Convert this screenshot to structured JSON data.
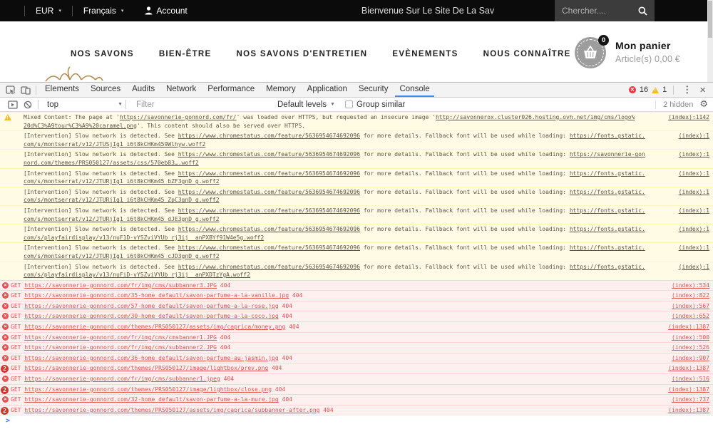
{
  "topbar": {
    "currency": "EUR",
    "language": "Français",
    "account": "Account",
    "welcome": "Bienvenue Sur Le Site De La Sav",
    "search_placeholder": "Chercher...."
  },
  "nav": {
    "items": [
      "NOS SAVONS",
      "BIEN-ÊTRE",
      "NOS SAVONS D'ENTRETIEN",
      "EVÈNEMENTS",
      "NOUS CONNAÎTRE"
    ],
    "cart": {
      "badge": "0",
      "label": "Mon panier",
      "summary": "Article(s) 0,00 €"
    }
  },
  "devtools": {
    "tabs": [
      "Elements",
      "Sources",
      "Audits",
      "Network",
      "Performance",
      "Memory",
      "Application",
      "Security",
      "Console"
    ],
    "active_tab": "Console",
    "error_count": "16",
    "warning_count": "1",
    "toolbar": {
      "context": "top",
      "filter_placeholder": "Filter",
      "levels": "Default levels",
      "group_similar": "Group similar",
      "hidden": "2 hidden"
    },
    "console": {
      "warnings": [
        {
          "icon": "warning",
          "source": "(index):1142",
          "line1": [
            {
              "t": "Mixed Content: The page at '"
            },
            {
              "t": "https://savonnerie-gonnord.com/fr/",
              "link": true
            },
            {
              "t": "' was loaded over HTTPS, but requested an insecure image '"
            },
            {
              "t": "http://savonnerox.cluster026.hosting.ovh.net/img/cms/logo%",
              "link": true
            }
          ],
          "line2": [
            {
              "t": "20d%C3%A9tour%C3%A9%20caramel.png",
              "link": true
            },
            {
              "t": "'. This content should also be served over HTTPS."
            }
          ]
        },
        {
          "icon": null,
          "source": "(index):1",
          "line1": [
            {
              "t": "[Intervention] Slow network is detected. See "
            },
            {
              "t": "https://www.chromestatus.com/feature/5636954674692096",
              "link": true
            },
            {
              "t": " for more details. Fallback font will be used while loading: "
            },
            {
              "t": "https://fonts.gstatic.",
              "link": true
            }
          ],
          "line2": [
            {
              "t": "com/s/montserrat/v12/JTUSjIg1_i6t8kCHKm459Wlhyw.woff2",
              "link": true
            }
          ]
        },
        {
          "icon": null,
          "source": "(index):1",
          "line1": [
            {
              "t": "[Intervention] Slow network is detected. See "
            },
            {
              "t": "https://www.chromestatus.com/feature/5636954674692096",
              "link": true
            },
            {
              "t": " for more details. Fallback font will be used while loading: "
            },
            {
              "t": "https://savonnerie-gon",
              "link": true
            }
          ],
          "line2": [
            {
              "t": "nord.com/themes/PRS050127/assets/css/570eb83….woff2",
              "link": true
            }
          ]
        },
        {
          "icon": null,
          "source": "(index):1",
          "line1": [
            {
              "t": "[Intervention] Slow network is detected. See "
            },
            {
              "t": "https://www.chromestatus.com/feature/5636954674692096",
              "link": true
            },
            {
              "t": " for more details. Fallback font will be used while loading: "
            },
            {
              "t": "https://fonts.gstatic.",
              "link": true
            }
          ],
          "line2": [
            {
              "t": "com/s/montserrat/v12/JTURjIg1_i6t8kCHKm45_bZF3gnD_g.woff2",
              "link": true
            }
          ]
        },
        {
          "icon": null,
          "source": "(index):1",
          "line1": [
            {
              "t": "[Intervention] Slow network is detected. See "
            },
            {
              "t": "https://www.chromestatus.com/feature/5636954674692096",
              "link": true
            },
            {
              "t": " for more details. Fallback font will be used while loading: "
            },
            {
              "t": "https://fonts.gstatic.",
              "link": true
            }
          ],
          "line2": [
            {
              "t": "com/s/montserrat/v12/JTURjIg1_i6t8kCHKm45_ZpC3gnD_g.woff2",
              "link": true
            }
          ]
        },
        {
          "icon": null,
          "source": "(index):1",
          "line1": [
            {
              "t": "[Intervention] Slow network is detected. See "
            },
            {
              "t": "https://www.chromestatus.com/feature/5636954674692096",
              "link": true
            },
            {
              "t": " for more details. Fallback font will be used while loading: "
            },
            {
              "t": "https://fonts.gstatic.",
              "link": true
            }
          ],
          "line2": [
            {
              "t": "com/s/montserrat/v12/JTURjIg1_i6t8kCHKm45_dJE3gnD_g.woff2",
              "link": true
            }
          ]
        },
        {
          "icon": null,
          "source": "(index):1",
          "line1": [
            {
              "t": "[Intervention] Slow network is detected. See "
            },
            {
              "t": "https://www.chromestatus.com/feature/5636954674692096",
              "link": true
            },
            {
              "t": " for more details. Fallback font will be used while loading: "
            },
            {
              "t": "https://fonts.gstatic.",
              "link": true
            }
          ],
          "line2": [
            {
              "t": "com/s/playfairdisplay/v13/nuF1D-vYSZviVYUb_rj3ij__anPXBYf91W4e5g.woff2",
              "link": true
            }
          ]
        },
        {
          "icon": null,
          "source": "(index):1",
          "line1": [
            {
              "t": "[Intervention] Slow network is detected. See "
            },
            {
              "t": "https://www.chromestatus.com/feature/5636954674692096",
              "link": true
            },
            {
              "t": " for more details. Fallback font will be used while loading: "
            },
            {
              "t": "https://fonts.gstatic.",
              "link": true
            }
          ],
          "line2": [
            {
              "t": "com/s/montserrat/v12/JTURjIg1_i6t8kCHKm45_cJD3gnD_g.woff2",
              "link": true
            }
          ]
        },
        {
          "icon": null,
          "source": "(index):1",
          "line1": [
            {
              "t": "[Intervention] Slow network is detected. See "
            },
            {
              "t": "https://www.chromestatus.com/feature/5636954674692096",
              "link": true
            },
            {
              "t": " for more details. Fallback font will be used while loading: "
            },
            {
              "t": "https://fonts.gstatic.",
              "link": true
            }
          ],
          "line2": [
            {
              "t": "com/s/playfairdisplay/v13/nuFiD-vYSZviVYUb_rj3ij__anPXDTzYgA.woff2",
              "link": true
            }
          ]
        }
      ],
      "errors": [
        {
          "badge": null,
          "method": "GET",
          "url": "https://savonnerie-gonnord.com/fr/img/cms/subbanner3.JPG",
          "status": "404",
          "source": "(index):534"
        },
        {
          "badge": null,
          "method": "GET",
          "url": "https://savonnerie-gonnord.com/35-home_default/savon-parfume-a-la-vanille.jpg",
          "status": "404",
          "source": "(index):822"
        },
        {
          "badge": null,
          "method": "GET",
          "url": "https://savonnerie-gonnord.com/57-home_default/savon-parfume-a-la-rose.jpg",
          "status": "404",
          "source": "(index):567"
        },
        {
          "badge": null,
          "method": "GET",
          "url": "https://savonnerie-gonnord.com/30-home_default/savon-parfume-a-la-coco.jpg",
          "status": "404",
          "source": "(index):652"
        },
        {
          "badge": null,
          "method": "GET",
          "url": "https://savonnerie-gonnord.com/themes/PRS050127/assets/img/caprica/money.png",
          "status": "404",
          "source": "(index):1387"
        },
        {
          "badge": null,
          "method": "GET",
          "url": "https://savonnerie-gonnord.com/fr/img/cms/cmsbanner1.JPG",
          "status": "404",
          "source": "(index):500"
        },
        {
          "badge": null,
          "method": "GET",
          "url": "https://savonnerie-gonnord.com/fr/img/cms/subbanner2.JPG",
          "status": "404",
          "source": "(index):526"
        },
        {
          "badge": null,
          "method": "GET",
          "url": "https://savonnerie-gonnord.com/36-home_default/savon-parfume-au-jasmin.jpg",
          "status": "404",
          "source": "(index):907"
        },
        {
          "badge": "2",
          "method": "GET",
          "url": "https://savonnerie-gonnord.com/themes/PRS050127/image/lightbox/prev.png",
          "status": "404",
          "source": "(index):1387"
        },
        {
          "badge": null,
          "method": "GET",
          "url": "https://savonnerie-gonnord.com/fr/img/cms/subbanner1.jpeg",
          "status": "404",
          "source": "(index):516"
        },
        {
          "badge": "2",
          "method": "GET",
          "url": "https://savonnerie-gonnord.com/themes/PRS050127/image/lightbox/close.png",
          "status": "404",
          "source": "(index):1387"
        },
        {
          "badge": null,
          "method": "GET",
          "url": "https://savonnerie-gonnord.com/32-home_default/savon-parfume-a-la-mure.jpg",
          "status": "404",
          "source": "(index):737"
        },
        {
          "badge": "2",
          "method": "GET",
          "url": "https://savonnerie-gonnord.com/themes/PRS050127/assets/img/caprica/subbanner-after.png",
          "status": "404",
          "source": "(index):1387"
        }
      ],
      "prompt": ">"
    }
  },
  "colors": {
    "accent_blue": "#4285f4",
    "warning_bg": "#fffbe5",
    "warning_border": "#fff5c2",
    "error_bg": "#fff0f0",
    "error_border": "#ffd6d6",
    "error_red": "#e35252",
    "topbar_black": "#0b0b0b"
  }
}
